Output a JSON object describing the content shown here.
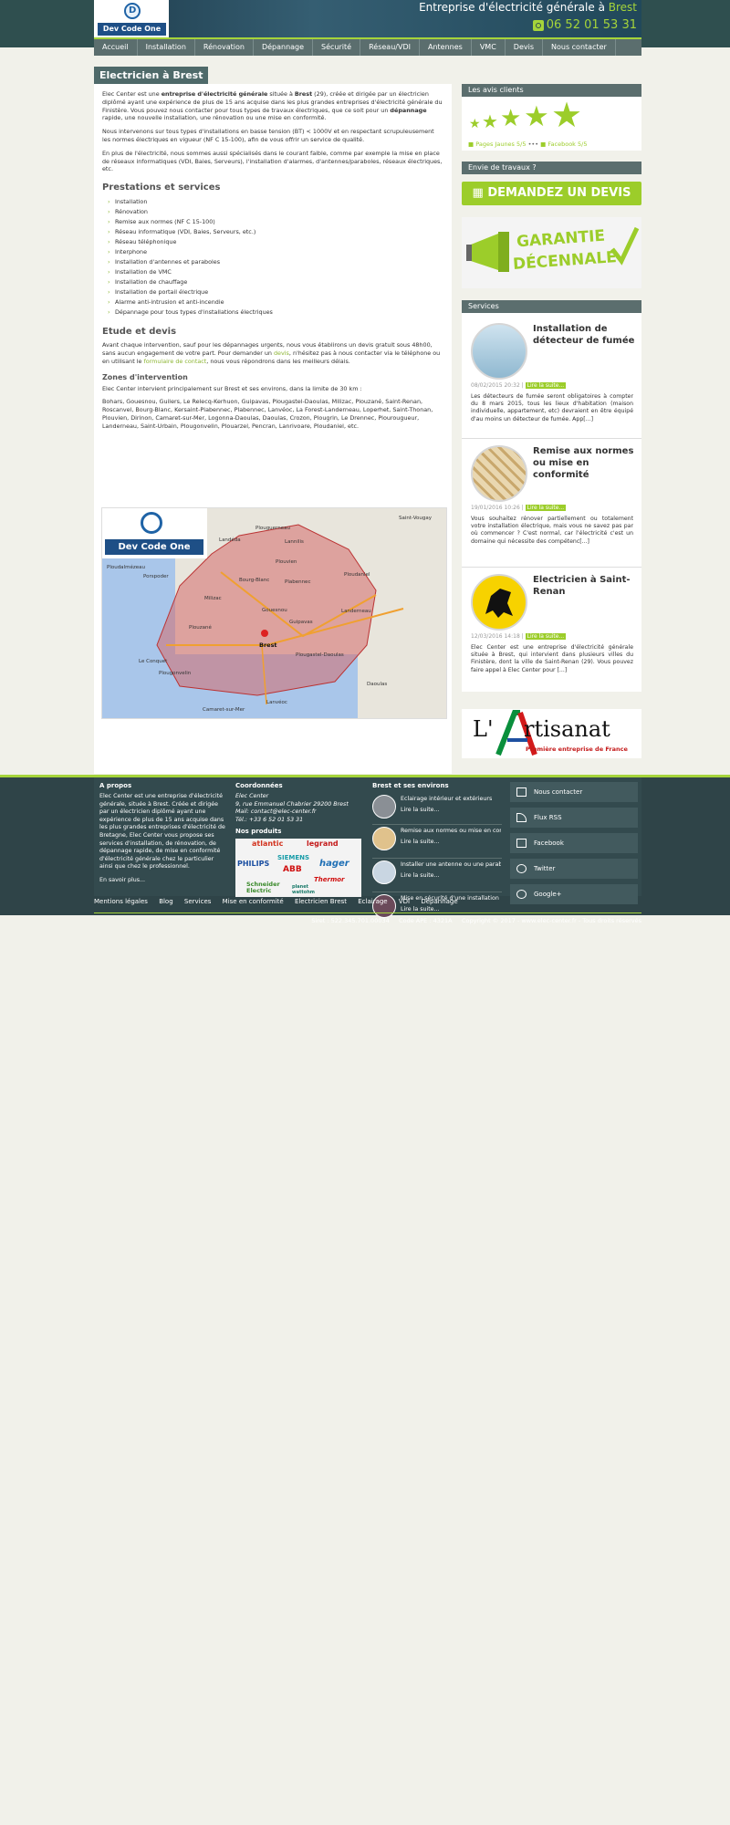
{
  "header": {
    "logo_text": "Dev Code One",
    "title_prefix": "Entreprise d'électricité générale à ",
    "title_city": "Brest",
    "phone": "06 52 01 53 31"
  },
  "nav": [
    "Accueil",
    "Installation",
    "Rénovation",
    "Dépannage",
    "Sécurité",
    "Réseau/VDI",
    "Antennes",
    "VMC",
    "Devis",
    "Nous contacter"
  ],
  "page_title": "Electricien à Brest",
  "intro": {
    "p1_a": "Elec Center est une ",
    "p1_b": "entreprise d'électricité générale",
    "p1_c": " située à ",
    "p1_d": "Brest",
    "p1_e": " (29), créée et dirigée par un électricien diplômé ayant une expérience de plus de 15 ans acquise dans les plus grandes entreprises d'électricité générale du Finistère. Vous pouvez nous contacter pour tous types de travaux électriques, que ce soit pour un ",
    "p1_f": "dépannage",
    "p1_g": " rapide, une nouvelle installation, une rénovation ou une mise en conformité.",
    "p2": "Nous intervenons sur tous types d'installations en basse tension (BT) < 1000V et en respectant scrupuleusement les normes électriques en vigueur (NF C 15-100), afin de vous offrir un service de qualité.",
    "p3": "En plus de l'électricité, nous sommes aussi spécialisés dans le courant faible, comme par exemple la mise en place de réseaux informatiques (VDI, Baies, Serveurs), l'installation d'alarmes, d'antennes/paraboles, réseaux électriques, etc."
  },
  "prestations": {
    "heading": "Prestations et services",
    "items": [
      "Installation",
      "Rénovation",
      "Remise aux normes (NF C 15-100)",
      "Réseau informatique (VDI, Baies, Serveurs, etc.)",
      "Réseau téléphonique",
      "Interphone",
      "Installation d'antennes et paraboles",
      "Installation de VMC",
      "Installation de chauffage",
      "Installation de portail électrique",
      "Alarme anti-intrusion et anti-incendie",
      "Dépannage pour tous types d'installations électriques"
    ]
  },
  "etude": {
    "heading": "Etude et devis",
    "t1": "Avant chaque intervention, sauf pour les dépannages urgents, nous vous établirons un devis gratuit sous 48h00, sans aucun engagement de votre part. Pour demander un ",
    "link1": "devis",
    "t2": ", n'hésitez pas à nous contacter via le téléphone ou en utilisant le ",
    "link2": "formulaire de contact",
    "t3": ", nous vous répondrons dans les meilleurs délais."
  },
  "zones": {
    "heading": "Zones d'intervention",
    "p1": "Elec Center intervient principalement sur Brest et ses environs, dans la limite de 30 km :",
    "p2": "Bohars, Gouesnou, Guilers, Le Relecq-Kerhuon, Guipavas, Plougastel-Daoulas, Milizac, Plouzané, Saint-Renan, Roscanvel, Bourg-Blanc, Kersaint-Plabennec, Plabennec, Lanvéoc, La Forest-Landerneau, Loperhet, Saint-Thonan, Plouvien, Dirinon, Camaret-sur-Mer, Logonna-Daoulas, Daoulas, Crozon, Plougrin, Le Drennec, Plourougueur, Landerneau, Saint-Urbain, Plougonvelin, Plouarzel, Pencran, Lanrivoare, Ploudaniel, etc."
  },
  "map": {
    "logo_text": "Dev Code One",
    "labels": [
      "Plouguerneau",
      "Landéda",
      "Lannilis",
      "Plouvien",
      "Bourg-Blanc",
      "Plabennec",
      "Ploudaniel",
      "Milizac",
      "Gouesnou",
      "Guipavas",
      "Landerneau",
      "Plouzané",
      "Brest",
      "Plougastel-Daoulas",
      "Le Conquet",
      "Plougonvelin",
      "Daoulas",
      "Lanvéoc",
      "Camaret-sur-Mer",
      "Saint-Vougay",
      "Ploudalmézeau",
      "Porspoder"
    ]
  },
  "sidebar": {
    "reviews": {
      "heading": "Les avis clients",
      "pj": "Pages Jaunes 5/5",
      "sep": "•••",
      "fb": "Facebook 5/5"
    },
    "devis": {
      "heading": "Envie de travaux ?",
      "button": "DEMANDEZ UN DEVIS"
    },
    "garantie": {
      "line1": "GARANTIE",
      "line2": "DÉCENNALE"
    },
    "services": {
      "heading": "Services",
      "items": [
        {
          "title": "Installation de détecteur de fumée",
          "date": "08/02/2015 20:32",
          "read": "Lire la suite...",
          "desc": "Les détecteurs de fumée seront obligatoires à compter du 8 mars 2015, tous les lieux d'habitation (maison individuelle, appartement, etc) devraient en être équipé d'au moins un détecteur de fumée. App[...]"
        },
        {
          "title": "Remise aux normes ou mise en conformité",
          "date": "19/01/2016 10:26",
          "read": "Lire la suite...",
          "desc": "Vous souhaitez rénover partiellement ou totalement votre installation électrique, mais vous ne savez pas par où commencer ? C'est normal, car l'électricité c'est un domaine qui nécessite des compétenc[...]"
        },
        {
          "title": "Electricien à Saint-Renan",
          "date": "12/03/2016 14:18",
          "read": "Lire la suite...",
          "desc": "Elec Center est une entreprise d'électricité générale située à Brest, qui intervient dans plusieurs villes du Finistère, dont la ville de Saint-Renan (29). Vous pouvez faire appel à Elec Center pour [...]"
        }
      ]
    },
    "artisanat": {
      "prefix": "L'",
      "word": "rtisanat",
      "sub": "Première entreprise de France"
    }
  },
  "footer": {
    "apropos": {
      "heading": "A propos",
      "text": "Elec Center est une entreprise d'électricité générale, située à Brest. Créée et dirigée par un électricien diplômé ayant une expérience de plus de 15 ans acquise dans les plus grandes entreprises d'électricité de Bretagne, Elec Center vous propose ses services d'installation, de rénovation, de dépannage rapide, de mise en conformité d'électricité générale chez le particulier ainsi que chez le professionnel.",
      "more": "En savoir plus..."
    },
    "coords": {
      "heading": "Coordonnées",
      "l1": "Elec Center",
      "l2": "9, rue Emmanuel Chabrier 29200 Brest",
      "l3": "Mail: contact@elec-center.fr",
      "l4": "Tél.: +33 6 52 01 53 31",
      "products_heading": "Nos produits",
      "brands": [
        "atlantic",
        "legrand",
        "SIEMENS",
        "PHILIPS",
        "ABB",
        "hager",
        "Schneider Electric",
        "Thermor",
        "planet wattohm"
      ]
    },
    "brest": {
      "heading": "Brest et ses environs",
      "items": [
        {
          "title": "Eclairage intérieur et extérieurs",
          "read": "Lire la suite..."
        },
        {
          "title": "Remise aux normes ou mise en conformité",
          "read": "Lire la suite..."
        },
        {
          "title": "Installer une antenne ou une parabole",
          "read": "Lire la suite..."
        },
        {
          "title": "Mise en sécurité d'une installation",
          "read": "Lire la suite..."
        }
      ]
    },
    "social": [
      "Nous contacter",
      "Flux RSS",
      "Facebook",
      "Twitter",
      "Google+"
    ],
    "links": [
      "Mentions légales",
      "Blog",
      "Services",
      "Mise en conformité",
      "Electricien Brest",
      "Eclairage",
      "VDI",
      "Dépannage"
    ],
    "siret": "Siret : 522.345.701.00034",
    "ape": "Code APE : 4321A",
    "copyright": "Copyright © 2017 - www.elec-center.fr - Tous droits réservés"
  },
  "colors": {
    "accent": "#a5d43a",
    "dark": "#2f4f4f",
    "nav": "#5b6e6e"
  }
}
